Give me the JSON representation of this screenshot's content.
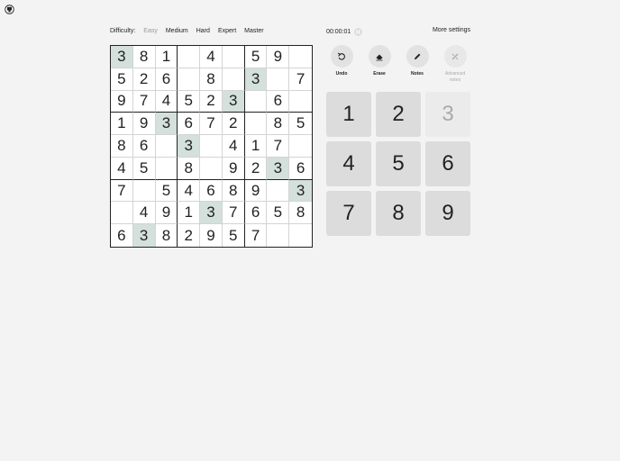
{
  "difficulty": {
    "label": "Difficulty:",
    "options": [
      "Easy",
      "Medium",
      "Hard",
      "Expert",
      "Master"
    ],
    "selected": "Easy"
  },
  "timer": "00:00:01",
  "more_settings": "More settings",
  "tools": {
    "undo": "Undo",
    "erase": "Erase",
    "notes": "Notes",
    "advanced_notes": "Advanced notes"
  },
  "board": [
    [
      "3",
      "8",
      "1",
      "",
      "4",
      "",
      "5",
      "9",
      ""
    ],
    [
      "5",
      "2",
      "6",
      "",
      "8",
      "",
      "3",
      "",
      "7"
    ],
    [
      "9",
      "7",
      "4",
      "5",
      "2",
      "3",
      "",
      "6",
      ""
    ],
    [
      "1",
      "9",
      "3",
      "6",
      "7",
      "2",
      "",
      "8",
      "5"
    ],
    [
      "8",
      "6",
      "",
      "3",
      "",
      "4",
      "1",
      "7",
      ""
    ],
    [
      "4",
      "5",
      "",
      "8",
      "",
      "9",
      "2",
      "3",
      "6"
    ],
    [
      "7",
      "",
      "5",
      "4",
      "6",
      "8",
      "9",
      "",
      "3"
    ],
    [
      "",
      "4",
      "9",
      "1",
      "3",
      "7",
      "6",
      "5",
      "8"
    ],
    [
      "6",
      "3",
      "8",
      "2",
      "9",
      "5",
      "7",
      "",
      ""
    ]
  ],
  "highlight_color": "#d3e0db",
  "highlighted_cells": [
    [
      0,
      0
    ],
    [
      1,
      6
    ],
    [
      2,
      5
    ],
    [
      3,
      2
    ],
    [
      4,
      3
    ],
    [
      5,
      7
    ],
    [
      6,
      8
    ],
    [
      7,
      4
    ],
    [
      8,
      1
    ]
  ],
  "numpad": [
    "1",
    "2",
    "3",
    "4",
    "5",
    "6",
    "7",
    "8",
    "9"
  ],
  "completed_numbers": [
    "3"
  ]
}
